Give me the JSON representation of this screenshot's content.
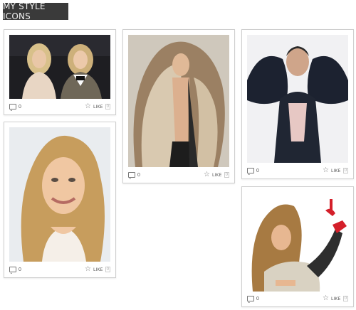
{
  "header": {
    "title": "MY STYLE ICONS"
  },
  "cards": [
    {
      "comments": "0",
      "like_label": "LIKE",
      "like_count": "0"
    },
    {
      "comments": "0",
      "like_label": "LIKE",
      "like_count": "0"
    },
    {
      "comments": "0",
      "like_label": "LIKE",
      "like_count": "0"
    },
    {
      "comments": "0",
      "like_label": "LIKE",
      "like_count": "0"
    },
    {
      "comments": "0",
      "like_label": "LIKE",
      "like_count": "0"
    }
  ]
}
